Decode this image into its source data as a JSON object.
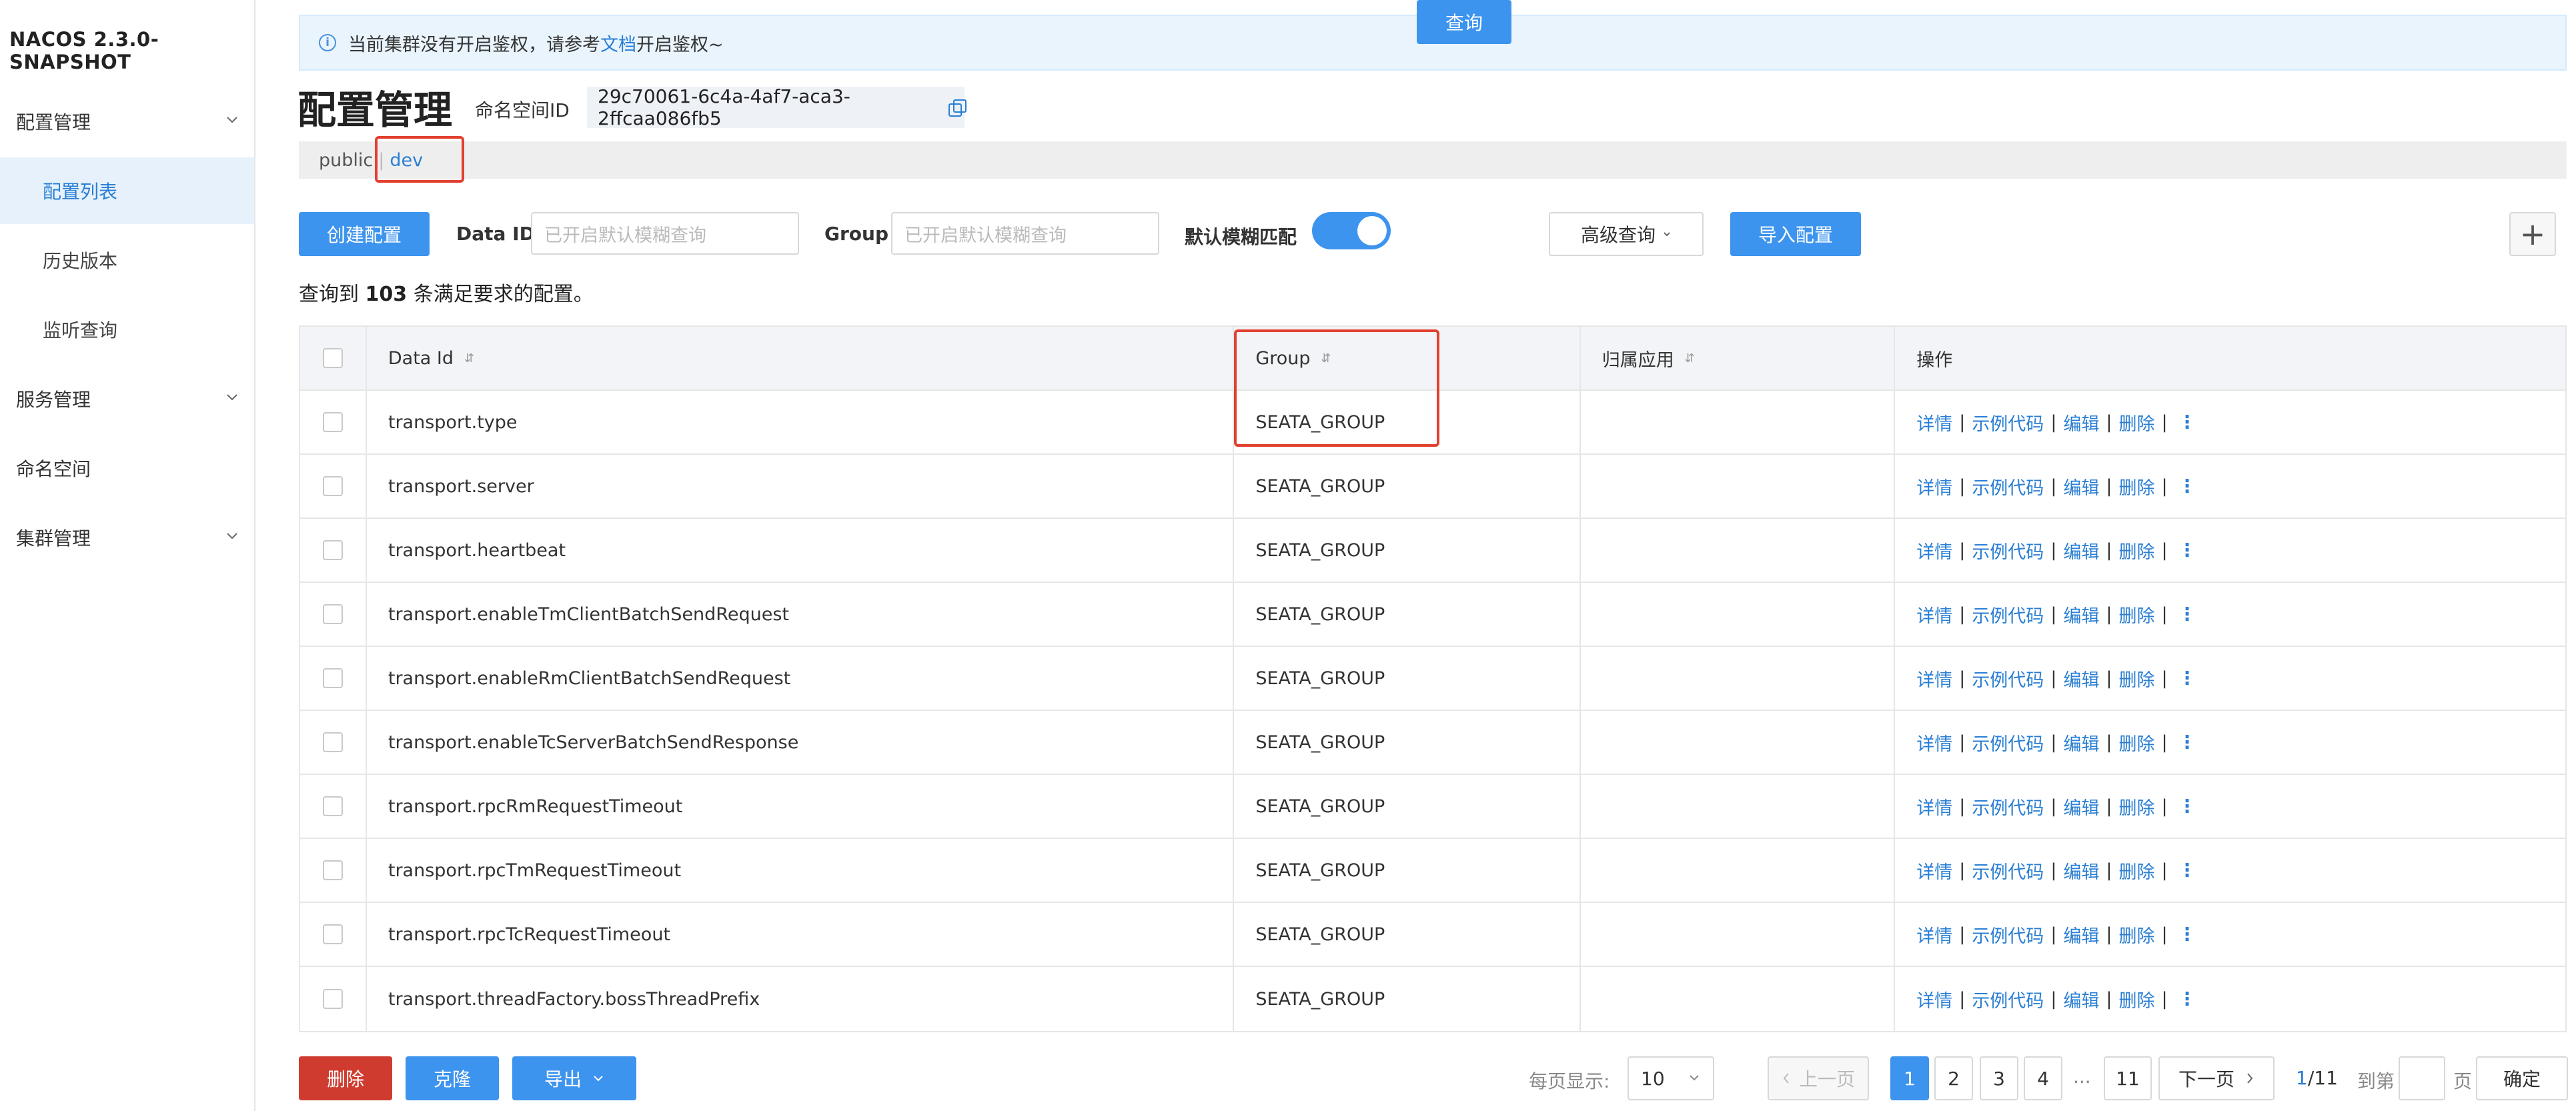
{
  "app": {
    "brand": "NACOS 2.3.0-SNAPSHOT"
  },
  "sidebar": {
    "config_mgmt": "配置管理",
    "config_list": "配置列表",
    "history": "历史版本",
    "listener": "监听查询",
    "service_mgmt": "服务管理",
    "namespace": "命名空间",
    "cluster_mgmt": "集群管理"
  },
  "alert": {
    "text_before": "当前集群没有开启鉴权，请参考",
    "link": "文档",
    "text_after": "开启鉴权~"
  },
  "header": {
    "title": "配置管理",
    "ns_label": "命名空间ID",
    "ns_value": "29c70061-6c4a-4af7-aca3-2ffcaa086fb5"
  },
  "ns_tabs": {
    "public": "public",
    "sep": "|",
    "dev": "dev"
  },
  "toolbar": {
    "create": "创建配置",
    "data_id_label": "Data ID",
    "data_id_placeholder": "已开启默认模糊查询",
    "group_label": "Group",
    "group_placeholder": "已开启默认模糊查询",
    "fuzzy_label": "默认模糊匹配",
    "fuzzy_on": true,
    "query": "查询",
    "advanced": "高级查询",
    "import": "导入配置",
    "plus": "+"
  },
  "summary": {
    "before": "查询到 ",
    "count": "103",
    "after": " 条满足要求的配置。"
  },
  "table": {
    "headers": {
      "data_id": "Data Id",
      "group": "Group",
      "app": "归属应用",
      "ops": "操作"
    },
    "ops": {
      "detail": "详情",
      "sample": "示例代码",
      "edit": "编辑",
      "delete": "删除",
      "sep": "|",
      "more": "⋮"
    },
    "rows": [
      {
        "data_id": "transport.type",
        "group": "SEATA_GROUP",
        "app": ""
      },
      {
        "data_id": "transport.server",
        "group": "SEATA_GROUP",
        "app": ""
      },
      {
        "data_id": "transport.heartbeat",
        "group": "SEATA_GROUP",
        "app": ""
      },
      {
        "data_id": "transport.enableTmClientBatchSendRequest",
        "group": "SEATA_GROUP",
        "app": ""
      },
      {
        "data_id": "transport.enableRmClientBatchSendRequest",
        "group": "SEATA_GROUP",
        "app": ""
      },
      {
        "data_id": "transport.enableTcServerBatchSendResponse",
        "group": "SEATA_GROUP",
        "app": ""
      },
      {
        "data_id": "transport.rpcRmRequestTimeout",
        "group": "SEATA_GROUP",
        "app": ""
      },
      {
        "data_id": "transport.rpcTmRequestTimeout",
        "group": "SEATA_GROUP",
        "app": ""
      },
      {
        "data_id": "transport.rpcTcRequestTimeout",
        "group": "SEATA_GROUP",
        "app": ""
      },
      {
        "data_id": "transport.threadFactory.bossThreadPrefix",
        "group": "SEATA_GROUP",
        "app": ""
      }
    ]
  },
  "footer": {
    "delete": "删除",
    "clone": "克隆",
    "export": "导出",
    "page_size_label": "每页显示:",
    "page_size": "10",
    "prev": "上一页",
    "pages": [
      "1",
      "2",
      "3",
      "4"
    ],
    "ellipsis": "...",
    "last_page": "11",
    "next": "下一页",
    "current_page": "1",
    "total_pages": "/11",
    "jump_before": "到第",
    "jump_after": "页",
    "confirm": "确定"
  },
  "colors": {
    "primary": "#3d94ee",
    "danger": "#cf3c2f",
    "highlight": "#e2402f",
    "link": "#2a7fd4"
  }
}
